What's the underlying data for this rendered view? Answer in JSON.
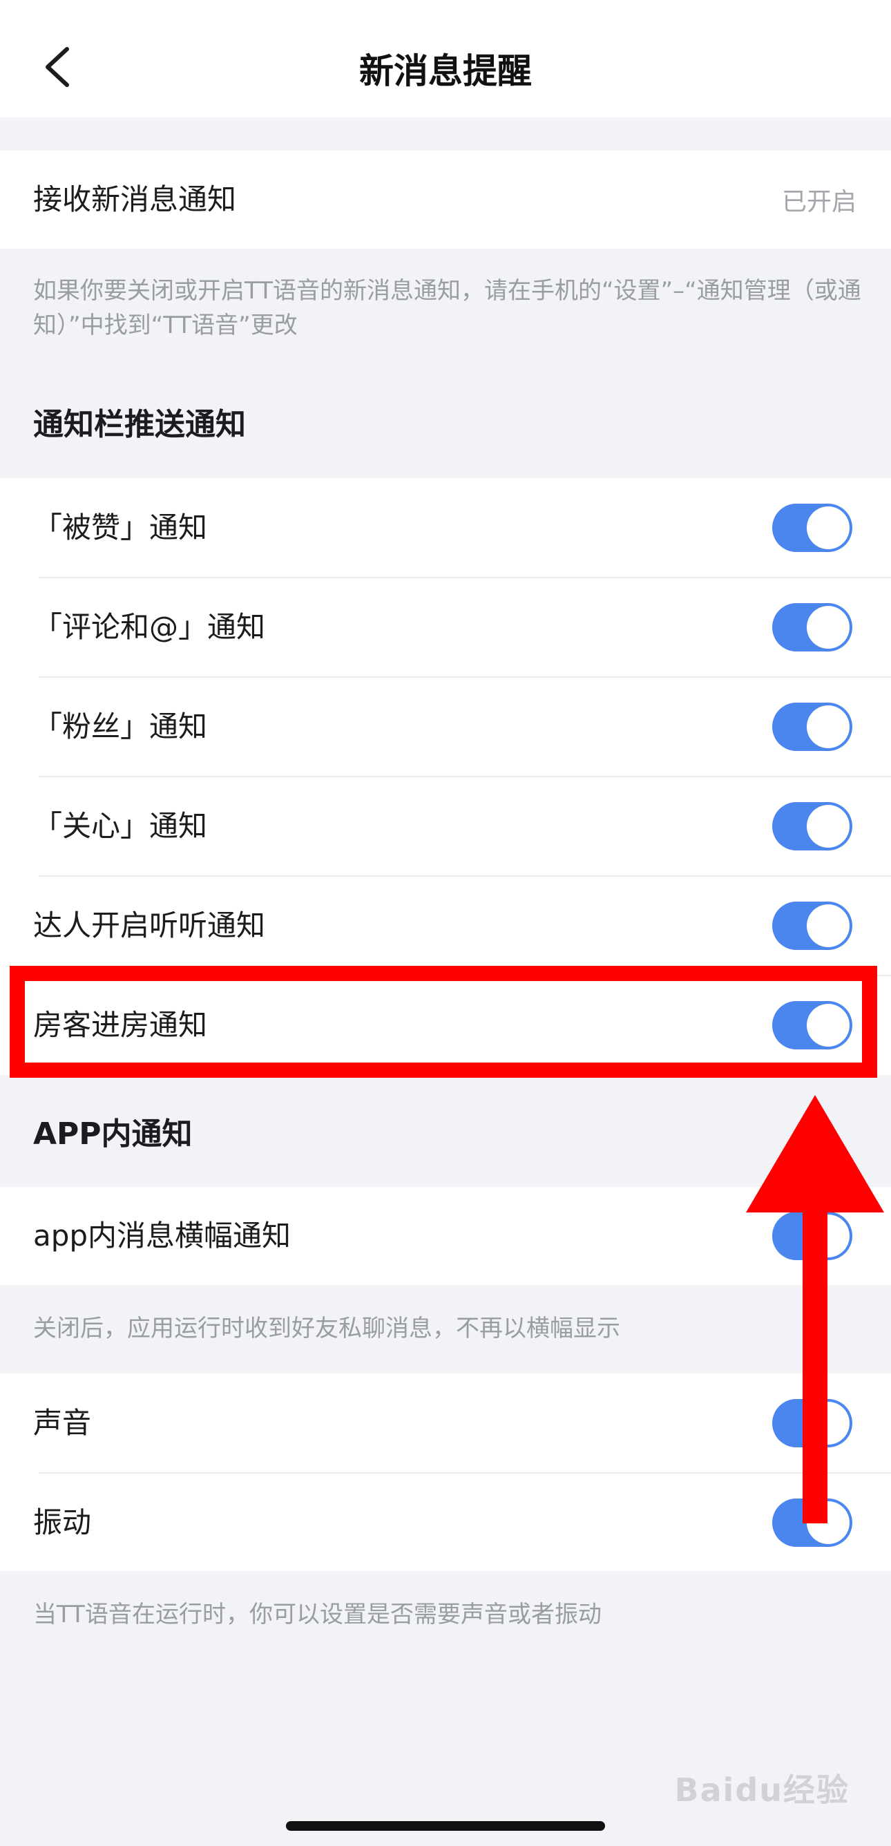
{
  "nav": {
    "title": "新消息提醒"
  },
  "receive": {
    "label": "接收新消息通知",
    "value": "已开启"
  },
  "receive_note": "如果你要关闭或开启TT语音的新消息通知，请在手机的“设置”–“通知管理（或通知）”中找到“TT语音”更改",
  "push_section": {
    "title": "通知栏推送通知",
    "items": [
      {
        "label": "「被赞」通知",
        "on": true
      },
      {
        "label": "「评论和@」通知",
        "on": true
      },
      {
        "label": "「粉丝」通知",
        "on": true
      },
      {
        "label": "「关心」通知",
        "on": true
      },
      {
        "label": "达人开启听听通知",
        "on": true
      },
      {
        "label": "房客进房通知",
        "on": true
      }
    ]
  },
  "app_section": {
    "title": "APP内通知",
    "banner": {
      "label": "app内消息横幅通知",
      "on": true
    },
    "banner_note": "关闭后，应用运行时收到好友私聊消息，不再以横幅显示"
  },
  "sound_section": {
    "sound": {
      "label": "声音",
      "on": true
    },
    "vibrate": {
      "label": "振动",
      "on": true
    },
    "note": "当TT语音在运行时，你可以设置是否需要声音或者振动"
  },
  "watermark": "Baidu经验",
  "colors": {
    "accent": "#4a86ee",
    "highlight": "#ff0000",
    "background": "#f2f3f7"
  }
}
